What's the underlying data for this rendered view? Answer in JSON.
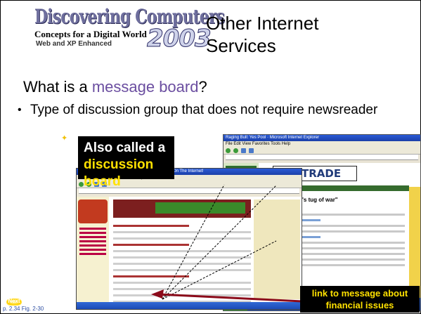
{
  "logo": {
    "title": "Discovering Computers",
    "subtitle": "Concepts for a Digital World",
    "year": "2003",
    "edition": "Web and XP Enhanced"
  },
  "slide_title": "Other Internet Services",
  "question": {
    "prefix": "What is a ",
    "highlight": "message board",
    "suffix": "?"
  },
  "bullet": "Type of discussion group that does not require newsreader",
  "callout": {
    "line1": "Also called a",
    "line2": "discussion board"
  },
  "link_callout": "link to message about financial issues",
  "screenshot": {
    "back_window_title": "Raging Bull: Yes Pool · Microsoft Internet Explorer",
    "back_menu": "File  Edit  View  Favorites  Tools  Help",
    "etrade_logo": "E*TRADE",
    "post_title": "\"Gold's tug of war\"",
    "front_window_title": "Raging Bull - The Best Financial Message Boards On The Internet!",
    "front_menu": "File  Edit  View  Favorites  Tools  Help"
  },
  "nav": {
    "next_label": "Next",
    "page_ref": "p. 2.34 Fig. 2-30"
  },
  "colors": {
    "highlight": "#6b4ea0",
    "callout_bg": "#000000",
    "callout_yellow": "#ffe100",
    "arrow_red": "#8b0a1a"
  }
}
